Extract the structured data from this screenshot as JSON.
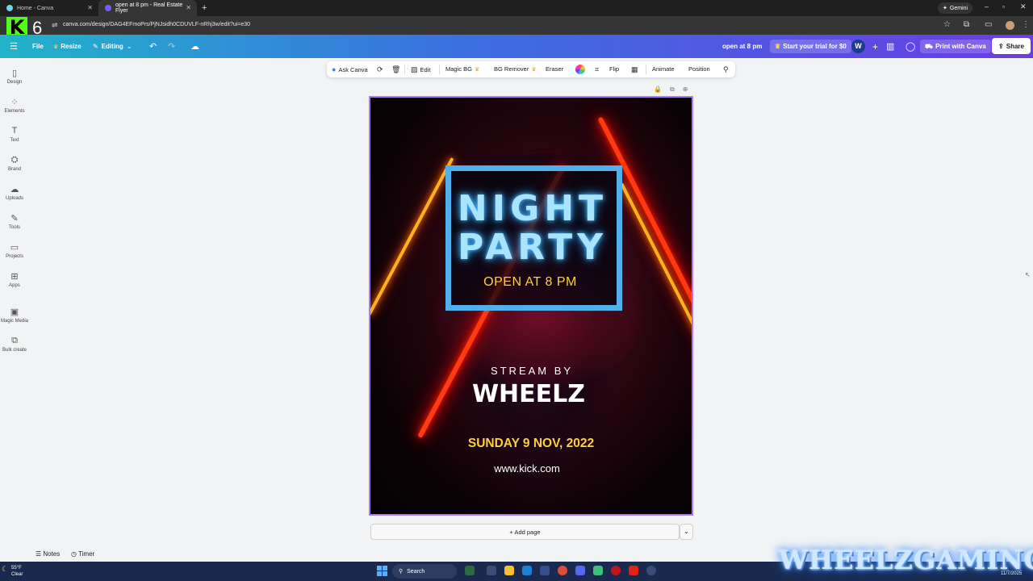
{
  "browser": {
    "tabs": [
      {
        "title": "Home - Canva",
        "active": false,
        "favicon_color": "#6dd5ed"
      },
      {
        "title": "open at 8 pm - Real Estate Flyer",
        "active": true,
        "favicon_color": "#7d5cff"
      }
    ],
    "new_tab": "+",
    "gemini_label": "Gemini",
    "url": "canva.com/design/DAG4EFmoPrs/PjNJsidh0CDUVLF-nRhj3w/edit?ui=e30",
    "window_controls": {
      "minimize": "–",
      "maximize": "▫",
      "close": "✕"
    }
  },
  "overlay": {
    "stream_number": "6",
    "watermark": "WHEELZGAMING"
  },
  "header": {
    "menu_icon": "hamburger-icon",
    "file": "File",
    "resize": "Resize",
    "editing": "Editing",
    "design_title": "open at 8 pm",
    "trial": "Start your trial for $0",
    "avatar_initial": "W",
    "print": "Print with Canva",
    "share": "Share"
  },
  "sidebar": {
    "items": [
      {
        "label": "Design",
        "icon": "design-icon"
      },
      {
        "label": "Elements",
        "icon": "elements-icon"
      },
      {
        "label": "Text",
        "icon": "text-icon"
      },
      {
        "label": "Brand",
        "icon": "brand-icon"
      },
      {
        "label": "Uploads",
        "icon": "uploads-icon"
      },
      {
        "label": "Tools",
        "icon": "tools-icon"
      },
      {
        "label": "Projects",
        "icon": "projects-icon"
      },
      {
        "label": "Apps",
        "icon": "apps-icon"
      },
      {
        "label": "Magic Media",
        "icon": "magic-media-icon"
      },
      {
        "label": "Bulk create",
        "icon": "bulk-create-icon"
      }
    ]
  },
  "toolbar": {
    "ask_canva": "Ask Canva",
    "edit": "Edit",
    "magic_bg": "Magic BG",
    "bg_remover": "BG Remover",
    "eraser": "Eraser",
    "flip": "Flip",
    "animate": "Animate",
    "position": "Position"
  },
  "design": {
    "title_line1": "NIGHT",
    "title_line2": "PARTY",
    "open_time": "OPEN AT 8 PM",
    "stream_by": "STREAM BY",
    "streamer": "WHEELZ",
    "date": "SUNDAY 9 NOV, 2022",
    "website": "www.kick.com",
    "colors": {
      "frame": "#4fb0ec",
      "accent_yellow": "#ffcf40",
      "neon_red": "#ff3a10"
    }
  },
  "footer": {
    "add_page": "+ Add page",
    "notes": "Notes",
    "timer": "Timer"
  },
  "taskbar": {
    "weather_temp": "55°F",
    "weather_desc": "Clear",
    "search": "Search",
    "date": "11/7/2025"
  }
}
